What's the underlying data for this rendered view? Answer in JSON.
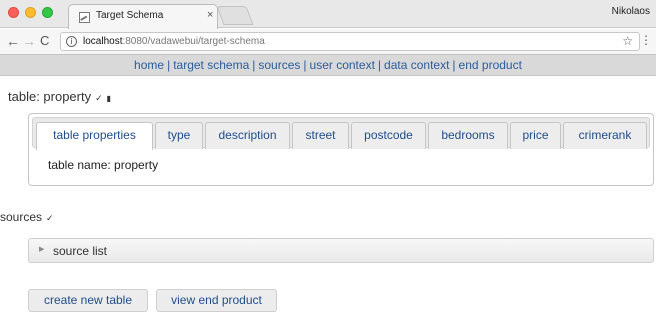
{
  "browser": {
    "tab_title": "Target Schema",
    "tab_close": "×",
    "profile_name": "Nikolaos",
    "url_host": "localhost",
    "url_rest": ":8080/vadawebui/target-schema"
  },
  "icons": {
    "back": "arrow-left-icon",
    "forward": "arrow-right-icon",
    "reload": "reload-icon",
    "info": "info-icon",
    "star": "star-icon",
    "menu": "kebab-menu-icon",
    "edit": "pencil-icon",
    "trash": "trash-icon",
    "caret": "caret-right-icon"
  },
  "site_nav": {
    "items": [
      "home",
      "target schema",
      "sources",
      "user context",
      "data context",
      "end product"
    ],
    "separator": "|"
  },
  "page": {
    "heading": "table: property"
  },
  "tabs": {
    "items": [
      "table properties",
      "type",
      "description",
      "street",
      "postcode",
      "bedrooms",
      "price",
      "crimerank"
    ],
    "active_index": 0,
    "content": "table name: property"
  },
  "sources": {
    "heading": "sources",
    "panel_label": "source list"
  },
  "buttons": {
    "create": "create new table",
    "view": "view end product"
  },
  "colors": {
    "link": "#2a5d9f",
    "nav_background": "#d9d9d9",
    "button_background": "#ececec"
  }
}
